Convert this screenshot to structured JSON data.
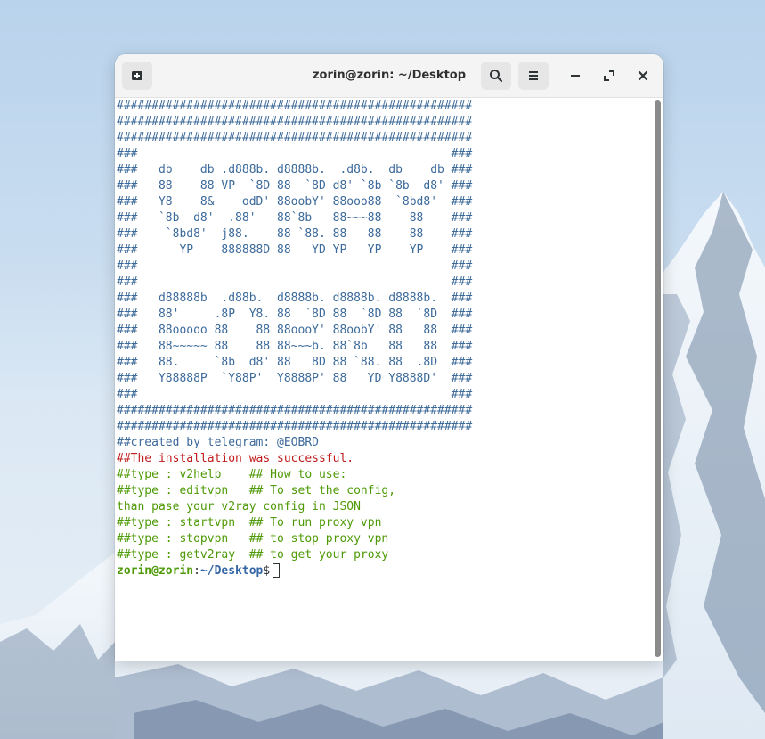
{
  "colors": {
    "banner": "#3c6a9a",
    "error_red": "#c01c1c",
    "prompt_green": "#4e9a06",
    "path_blue": "#3465a4"
  },
  "window": {
    "title": "zorin@zorin: ~/Desktop",
    "new_tab_icon": "new-tab-icon",
    "search_icon": "search-icon",
    "menu_icon": "hamburger-menu-icon",
    "minimize_icon": "minimize-icon",
    "maximize_icon": "maximize-icon",
    "close_icon": "close-icon"
  },
  "terminal": {
    "banner": [
      "###################################################",
      "###################################################",
      "###################################################",
      "###                                             ###",
      "###   db    db .d888b. d8888b.  .d8b.  db    db ###",
      "###   88    88 VP  `8D 88  `8D d8' `8b `8b  d8' ###",
      "###   Y8    8&    odD' 88oobY' 88ooo88  `8bd8'  ###",
      "###   `8b  d8'  .88'   88`8b   88~~~88    88    ###",
      "###    `8bd8'  j88.    88 `88. 88   88    88    ###",
      "###      YP    888888D 88   YD YP   YP    YP    ###",
      "###                                             ###",
      "###                                             ###",
      "###   d88888b  .d88b.  d8888b. d8888b. d8888b.  ###",
      "###   88'     .8P  Y8. 88  `8D 88  `8D 88  `8D  ###",
      "###   88ooooo 88    88 88oooY' 88oobY' 88   88  ###",
      "###   88~~~~~ 88    88 88~~~b. 88`8b   88   88  ###",
      "###   88.     `8b  d8' 88   8D 88 `88. 88  .8D  ###",
      "###   Y88888P  `Y88P'  Y8888P' 88   YD Y8888D'  ###",
      "###                                             ###",
      "###################################################",
      "###################################################"
    ],
    "created_by": "##created by telegram: @EOBRD",
    "success": "##The installation was successful.",
    "help": [
      "##type : v2help    ## How to use:",
      "##type : editvpn   ## To set the config,",
      "than pase your v2ray config in JSON",
      "##type : startvpn  ## To run proxy vpn",
      "##type : stopvpn   ## to stop proxy vpn",
      "##type : getv2ray  ## to get your proxy"
    ],
    "prompt_user": "zorin@zorin",
    "prompt_sep": ":",
    "prompt_path": "~/Desktop",
    "prompt_symbol": "$"
  }
}
